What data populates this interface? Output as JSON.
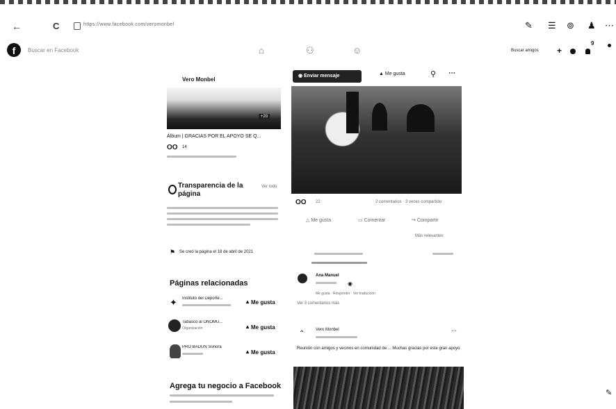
{
  "browser": {
    "back_icon": "←",
    "reload_icon": "C",
    "url": "https://www.facebook.com/veromonbel"
  },
  "fb_header": {
    "search_placeholder": "Buscar en Facebook",
    "find_friends": "Buscar amigos",
    "plus": "+",
    "notif_count": "9"
  },
  "left": {
    "page_name": "Vero Monbel",
    "photo_count": "+20",
    "album_title": "Álbum | GRACIAS POR EL APOYO SE Q...",
    "reaction_count": "14",
    "transparency_title": "Transparencia de la página",
    "transparency_see_all": "Ver todo",
    "created_text": "Se creó la página el 18 de abril de 2021",
    "related_title": "Páginas relacionadas",
    "related": [
      {
        "name": "Instituto del Deporte...",
        "sub": "",
        "like": "Me gusta"
      },
      {
        "name": "Tabasco al ONOMU...",
        "sub": "Organización",
        "like": "Me gusta"
      },
      {
        "name": "PRO BADUN Sonora",
        "sub": "",
        "like": "Me gusta"
      }
    ],
    "business_title": "Agrega tu negocio a Facebook"
  },
  "main": {
    "send_message": "Enviar mensaje",
    "like_label": "Me gusta",
    "post_reactions": "22",
    "post_comments": "2 comentarios · 3 veces compartido",
    "action_like": "Me gusta",
    "action_comment": "Comentar",
    "action_share": "Compartir",
    "most_relevant": "Más relevantes",
    "reply_name": "Ana Manuel",
    "reply_text": "Me gusta · Responder · Ver traducción",
    "more_comments": "Ver 3 comentarios más",
    "post2_author": "Vero Monbel",
    "post2_text": "Reunión con amigos y vecinos en comunidad de ... Muchas gracias por este gran apoyo"
  }
}
